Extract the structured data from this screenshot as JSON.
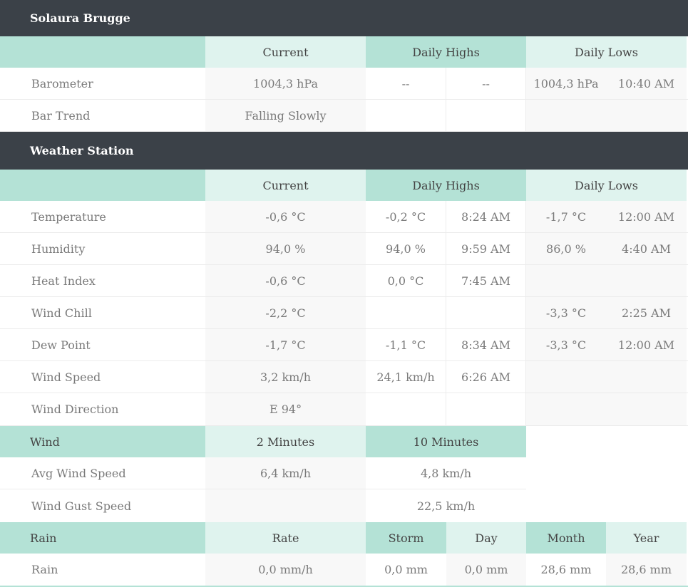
{
  "section1": {
    "title": "Solaura Brugge",
    "header": [
      "",
      "Current",
      "Daily Highs",
      "Daily Lows"
    ],
    "rows": [
      {
        "label": "Barometer",
        "current": "1004,3 hPa",
        "high": "--",
        "high_time": "--",
        "low": "1004,3 hPa",
        "low_time": "10:40 AM"
      },
      {
        "label": "Bar Trend",
        "current": "Falling Slowly",
        "high": "",
        "high_time": "",
        "low": "",
        "low_time": ""
      }
    ]
  },
  "section2": {
    "title": "Weather Station",
    "header": [
      "",
      "Current",
      "Daily Highs",
      "Daily Lows"
    ],
    "rows": [
      {
        "label": "Temperature",
        "current": "-0,6 °C",
        "high": "-0,2 °C",
        "high_time": "8:24 AM",
        "low": "-1,7 °C",
        "low_time": "12:00 AM"
      },
      {
        "label": "Humidity",
        "current": "94,0 %",
        "high": "94,0 %",
        "high_time": "9:59 AM",
        "low": "86,0 %",
        "low_time": "4:40 AM"
      },
      {
        "label": "Heat Index",
        "current": "-0,6 °C",
        "high": "0,0 °C",
        "high_time": "7:45 AM",
        "low": "",
        "low_time": ""
      },
      {
        "label": "Wind Chill",
        "current": "-2,2 °C",
        "high": "",
        "high_time": "",
        "low": "-3,3 °C",
        "low_time": "2:25 AM"
      },
      {
        "label": "Dew Point",
        "current": "-1,7 °C",
        "high": "-1,1 °C",
        "high_time": "8:34 AM",
        "low": "-3,3 °C",
        "low_time": "12:00 AM"
      },
      {
        "label": "Wind Speed",
        "current": "3,2 km/h",
        "high": "24,1 km/h",
        "high_time": "6:26 AM",
        "low": "",
        "low_time": ""
      },
      {
        "label": "Wind Direction",
        "current": "E 94°",
        "high": "",
        "high_time": "",
        "low": "",
        "low_time": ""
      }
    ]
  },
  "wind": {
    "header": [
      "Wind",
      "2 Minutes",
      "10 Minutes"
    ],
    "rows": [
      {
        "label": "Avg Wind Speed",
        "two_min": "6,4 km/h",
        "ten_min": "4,8 km/h"
      },
      {
        "label": "Wind Gust Speed",
        "two_min": "",
        "ten_min": "22,5 km/h"
      }
    ]
  },
  "rain": {
    "header": [
      "Rain",
      "Rate",
      "Storm",
      "Day",
      "Month",
      "Year"
    ],
    "row": {
      "label": "Rain",
      "rate": "0,0 mm/h",
      "storm": "0,0 mm",
      "day": "0,0 mm",
      "month": "28,6 mm",
      "year": "28,6 mm"
    }
  },
  "colors": {
    "title_bar": "#3b4148",
    "header_dark": "#b4e2d6",
    "header_light": "#dff3ee",
    "cell_grey": "#f8f8f8"
  }
}
